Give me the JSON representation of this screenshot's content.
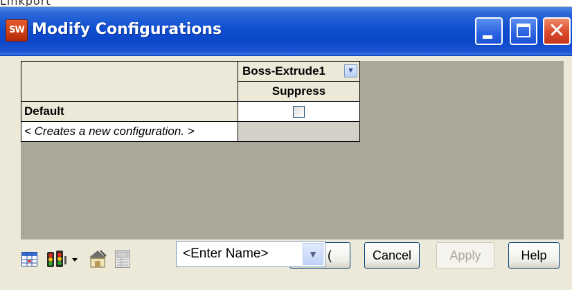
{
  "behind": {
    "text": "Linkport"
  },
  "window": {
    "title": "Modify Configurations",
    "app_icon_label": "SW",
    "controls": {
      "minimize": "minimize",
      "maximize": "maximize",
      "close": "close"
    }
  },
  "table": {
    "feature_header": "Boss-Extrude1",
    "parameter_header": "Suppress",
    "rows": [
      {
        "name": "Default",
        "suppress": false
      },
      {
        "name": "< Creates a new configuration. >",
        "suppress": null
      }
    ]
  },
  "toolbar": {
    "icons": [
      "table-view-icon",
      "traffic-light-icon",
      "dropdown-arrow-icon",
      "properties-icon",
      "save-table-icon"
    ]
  },
  "name_combo": {
    "value": "<Enter Name>"
  },
  "buttons": {
    "ok_partial": "(",
    "cancel": "Cancel",
    "apply": "Apply",
    "help": "Help"
  }
}
